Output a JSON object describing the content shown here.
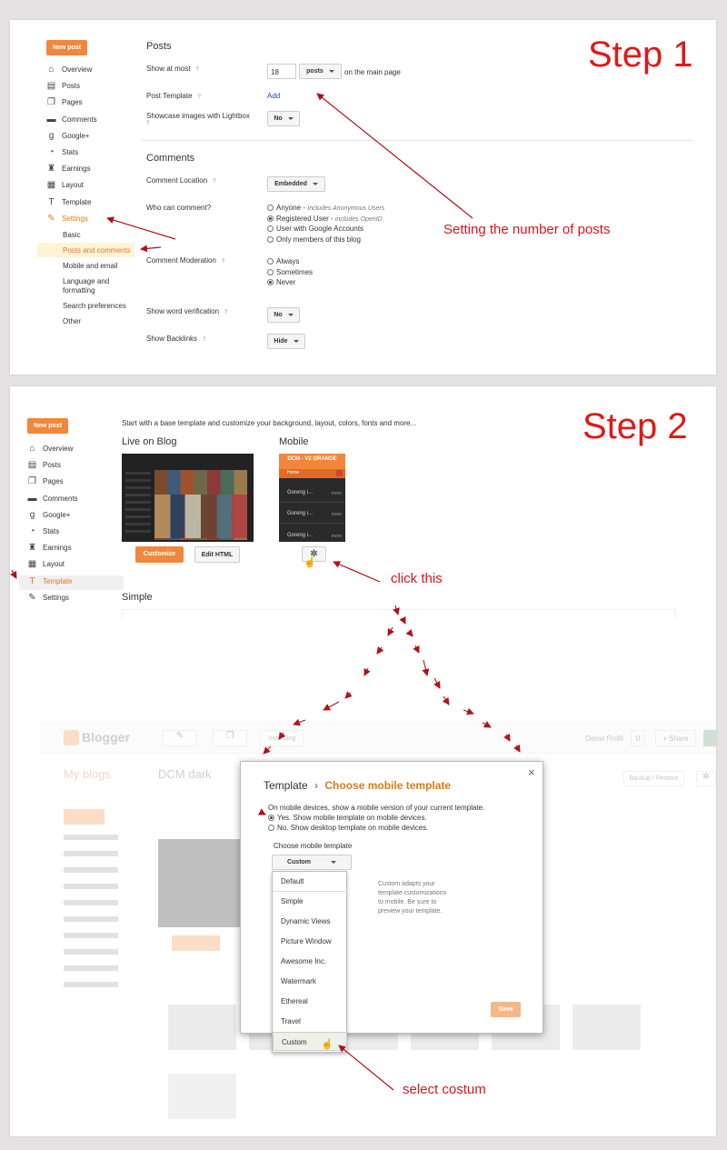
{
  "step1": {
    "step_label": "Step 1",
    "new_post": "New post",
    "nav": [
      {
        "label": "Overview",
        "icon": "home-icon"
      },
      {
        "label": "Posts",
        "icon": "posts-icon"
      },
      {
        "label": "Pages",
        "icon": "pages-icon"
      },
      {
        "label": "Comments",
        "icon": "comments-icon"
      },
      {
        "label": "Google+",
        "icon": "google-plus-icon"
      },
      {
        "label": "Stats",
        "icon": "stats-icon"
      },
      {
        "label": "Earnings",
        "icon": "trophy-icon"
      },
      {
        "label": "Layout",
        "icon": "layout-icon"
      },
      {
        "label": "Template",
        "icon": "template-icon"
      },
      {
        "label": "Settings",
        "icon": "wrench-icon"
      }
    ],
    "settings_sub": [
      "Basic",
      "Posts and comments",
      "Mobile and email",
      "Language and",
      "formatting",
      "Search preferences",
      "Other"
    ],
    "posts_title": "Posts",
    "show_at_most_label": "Show at most",
    "show_at_most_value": "18",
    "show_at_most_unit": "posts",
    "on_main_page": "on the main page",
    "post_template_label": "Post Template",
    "post_template_link": "Add",
    "lightbox_label": "Showcase images with Lightbox",
    "lightbox_value": "No",
    "comments_title": "Comments",
    "comment_location_label": "Comment Location",
    "comment_location_value": "Embedded",
    "who_can_comment_label": "Who can comment?",
    "who_options": [
      {
        "text": "Anyone - ",
        "note": "Includes Anonymous Users",
        "checked": false
      },
      {
        "text": "Registered User - ",
        "note": "includes OpenID",
        "checked": true
      },
      {
        "text": "User with Google Accounts",
        "note": "",
        "checked": false
      },
      {
        "text": "Only members of this blog",
        "note": "",
        "checked": false
      }
    ],
    "moderation_label": "Comment Moderation",
    "moderation_options": [
      {
        "text": "Always",
        "checked": false
      },
      {
        "text": "Sometimes",
        "checked": false
      },
      {
        "text": "Never",
        "checked": true
      }
    ],
    "word_verif_label": "Show word verification",
    "word_verif_value": "No",
    "backlinks_label": "Show Backlinks",
    "backlinks_value": "Hide",
    "annotation": "Setting the number of posts"
  },
  "step2": {
    "step_label": "Step 2",
    "new_post": "New post",
    "nav": [
      {
        "label": "Overview",
        "icon": "home-icon"
      },
      {
        "label": "Posts",
        "icon": "posts-icon"
      },
      {
        "label": "Pages",
        "icon": "pages-icon"
      },
      {
        "label": "Comments",
        "icon": "comments-icon"
      },
      {
        "label": "Google+",
        "icon": "google-plus-icon"
      },
      {
        "label": "Stats",
        "icon": "stats-icon"
      },
      {
        "label": "Earnings",
        "icon": "trophy-icon"
      },
      {
        "label": "Layout",
        "icon": "layout-icon"
      },
      {
        "label": "Template",
        "icon": "template-icon"
      },
      {
        "label": "Settings",
        "icon": "wrench-icon"
      }
    ],
    "intro": "Start with a base template and customize your background, layout, colors, fonts and more...",
    "live_on_blog": "Live on Blog",
    "mobile": "Mobile",
    "mobile_header": "DCM - V2 ORANGE",
    "mobile_home": "Home",
    "mobile_rows": [
      "Goreng i...",
      "Goreng i...",
      "Goreng i..."
    ],
    "mobile_more": "more",
    "customize": "Customize",
    "edit_html": "Edit HTML",
    "simple": "Simple",
    "click_this": "click this",
    "bg_logo": "Blogger",
    "bg_view_blog": "View blog",
    "bg_demo_profil": "Demo Profil",
    "bg_zero": "0",
    "bg_share": "+ Share",
    "bg_my_blogs": "My blogs",
    "bg_blog_name": "DCM dark",
    "bg_backup": "Backup / Restore",
    "dialog": {
      "crumb_root": "Template",
      "crumb_sep": "›",
      "crumb_current": "Choose mobile template",
      "on_mobile_text": "On mobile devices, show a mobile version of your current template.",
      "yes_option": "Yes. Show mobile template on mobile devices.",
      "no_option": "No. Show desktop template on mobile devices.",
      "choose_label": "Choose mobile template",
      "selected": "Custom",
      "options": [
        "Default",
        "Simple",
        "Dynamic Views",
        "Picture Window",
        "Awesome Inc.",
        "Watermark",
        "Ethereal",
        "Travel",
        "Custom"
      ],
      "help": [
        "Custom adapts your",
        "template customizations",
        "to mobile. Be sure to",
        "preview your template."
      ],
      "save": "Save",
      "close": "×"
    },
    "select_custom": "select costum"
  },
  "colors": {
    "accent": "#f1873d",
    "annotation": "#d9151c",
    "link": "#1a4bb8"
  }
}
